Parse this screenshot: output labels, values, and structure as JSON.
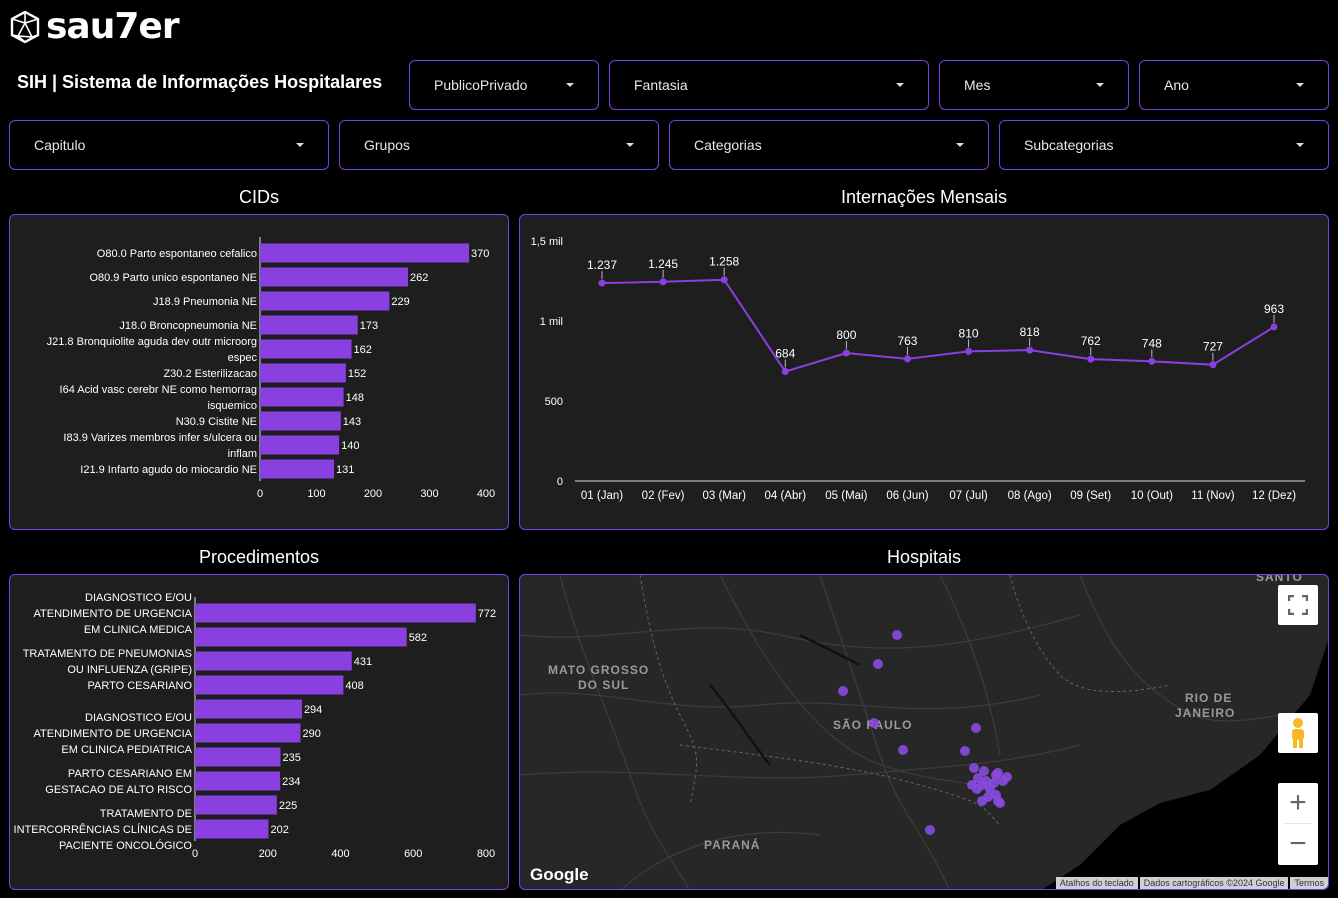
{
  "brand": {
    "name": "sau7er",
    "logo_icon": "geodesic-logo-icon"
  },
  "app_title": "SIH | Sistema de Informações Hospitalares",
  "filters": {
    "row1": [
      {
        "label": "PublicoPrivado"
      },
      {
        "label": "Fantasia"
      },
      {
        "label": "Mes"
      },
      {
        "label": "Ano"
      }
    ],
    "row2": [
      {
        "label": "Capitulo"
      },
      {
        "label": "Grupos"
      },
      {
        "label": "Categorias"
      },
      {
        "label": "Subcategorias"
      }
    ]
  },
  "sections": {
    "cids": "CIDs",
    "monthly": "Internações Mensais",
    "procedures": "Procedimentos",
    "hospitals": "Hospitais"
  },
  "colors": {
    "accent": "#7b3fe0",
    "bar": "#8a3fe0",
    "panel": "#1e1e1e"
  },
  "chart_data": [
    {
      "id": "cids",
      "type": "bar",
      "orientation": "horizontal",
      "categories": [
        [
          "O80.0 Parto espontaneo cefalico"
        ],
        [
          "O80.9 Parto unico espontaneo NE"
        ],
        [
          "J18.9 Pneumonia NE"
        ],
        [
          "J18.0 Broncopneumonia NE"
        ],
        [
          "J21.8 Bronquiolite aguda dev outr microorg",
          "espec"
        ],
        [
          "Z30.2 Esterilizacao"
        ],
        [
          "I64 Acid vasc cerebr NE como hemorrag",
          "isquemico"
        ],
        [
          "N30.9 Cistite NE"
        ],
        [
          "I83.9 Varizes membros infer s/ulcera ou",
          "inflam"
        ],
        [
          "I21.9 Infarto agudo do miocardio NE"
        ]
      ],
      "values": [
        370,
        262,
        229,
        173,
        162,
        152,
        148,
        143,
        140,
        131
      ],
      "xlim": [
        0,
        400
      ],
      "xticks": [
        "0",
        "100",
        "200",
        "300",
        "400"
      ]
    },
    {
      "id": "monthly",
      "type": "line",
      "categories": [
        "01 (Jan)",
        "02 (Fev)",
        "03 (Mar)",
        "04 (Abr)",
        "05 (Mai)",
        "06 (Jun)",
        "07 (Jul)",
        "08 (Ago)",
        "09 (Set)",
        "10 (Out)",
        "11 (Nov)",
        "12 (Dez)"
      ],
      "values": [
        1237,
        1245,
        1258,
        684,
        800,
        763,
        810,
        818,
        762,
        748,
        727,
        963
      ],
      "value_labels": [
        "1.237",
        "1.245",
        "1.258",
        "684",
        "800",
        "763",
        "810",
        "818",
        "762",
        "748",
        "727",
        "963"
      ],
      "ylim": [
        0,
        1500
      ],
      "yticks": [
        {
          "v": 0,
          "label": "0"
        },
        {
          "v": 500,
          "label": "500"
        },
        {
          "v": 1000,
          "label": "1 mil"
        },
        {
          "v": 1500,
          "label": "1,5 mil"
        }
      ]
    },
    {
      "id": "procedures",
      "type": "bar",
      "orientation": "horizontal",
      "categories": [
        [
          "DIAGNOSTICO E/OU",
          "ATENDIMENTO DE URGENCIA",
          "EM CLINICA MEDICA"
        ],
        [],
        [
          "TRATAMENTO DE PNEUMONIAS",
          "OU INFLUENZA (GRIPE)"
        ],
        [
          "PARTO CESARIANO"
        ],
        [],
        [
          "DIAGNOSTICO E/OU",
          "ATENDIMENTO DE URGENCIA",
          "EM CLINICA PEDIATRICA"
        ],
        [],
        [
          "PARTO CESARIANO EM",
          "GESTACAO DE ALTO RISCO"
        ],
        [],
        [
          "TRATAMENTO DE",
          "INTERCORRÊNCIAS CLÍNICAS DE",
          "PACIENTE ONCOLÓGICO"
        ]
      ],
      "values": [
        772,
        582,
        431,
        408,
        294,
        290,
        235,
        234,
        225,
        202
      ],
      "xlim": [
        0,
        800
      ],
      "xticks": [
        "0",
        "200",
        "400",
        "600",
        "800"
      ]
    }
  ],
  "map": {
    "labels": [
      "MATO GROSSO",
      "DO SUL",
      "SÃO PAULO",
      "RIO DE",
      "JANEIRO",
      "PARANÁ",
      "SANTO"
    ],
    "controls": {
      "fullscreen_icon": "fullscreen-icon",
      "pegman_icon": "pegman-icon",
      "zoom_in": "+",
      "zoom_out": "−"
    },
    "google": "Google",
    "attribution": [
      "Atalhos do teclado",
      "Dados cartográficos ©2024 Google",
      "Termos"
    ],
    "marker_color": "#8a4be0"
  }
}
